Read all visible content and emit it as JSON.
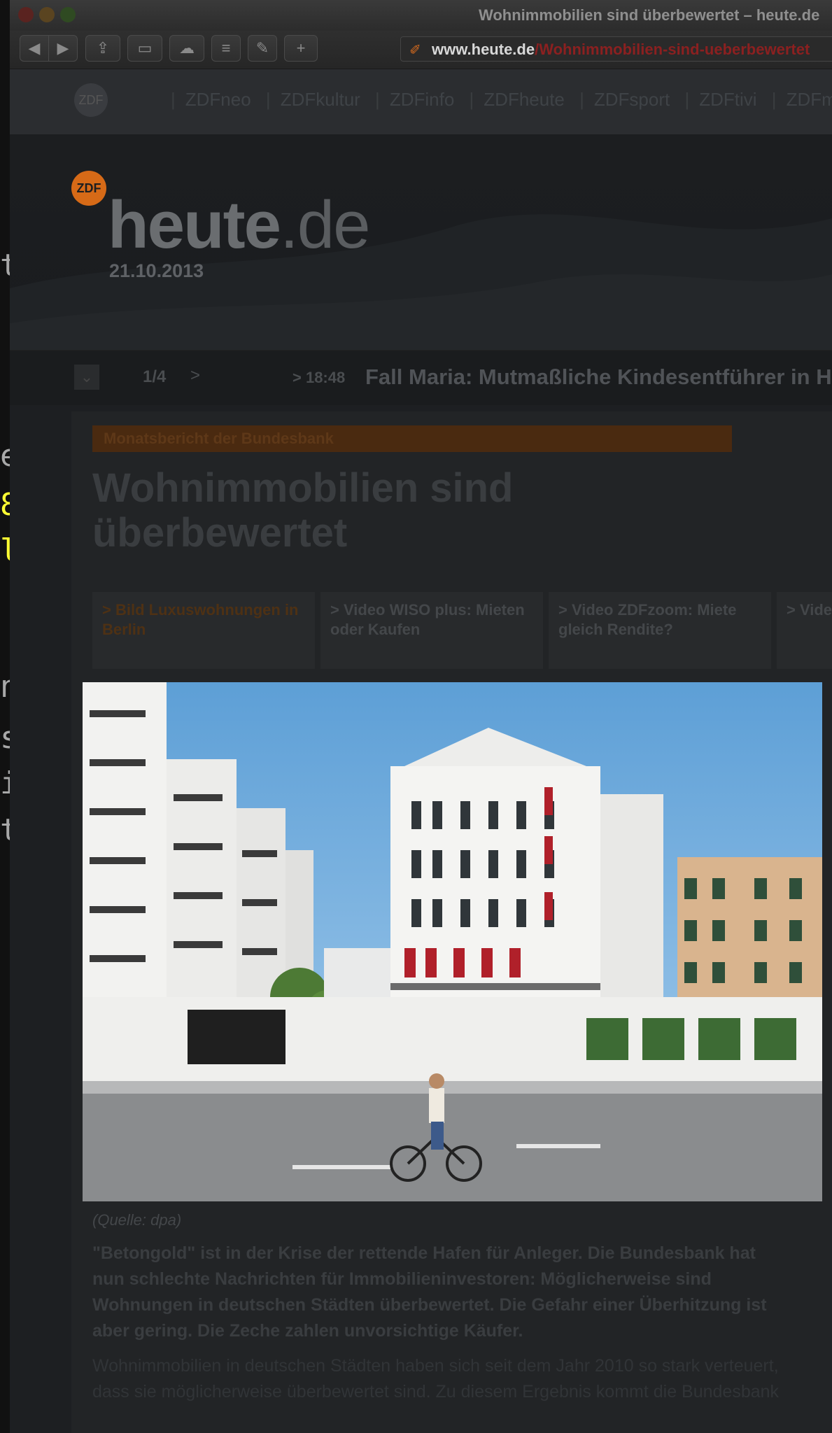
{
  "terminal": {
    "chars": [
      "t",
      "e",
      "8",
      "l",
      "n",
      "s",
      "i",
      "t"
    ]
  },
  "window": {
    "title": "Wohnimmobilien sind überbewertet – heute.de"
  },
  "toolbar": {
    "url_host": "www.heute.de",
    "url_path": "/Wohnimmobilien-sind-ueberbewertet"
  },
  "network": {
    "logo": "ZDF",
    "links": [
      "ZDFneo",
      "ZDFkultur",
      "ZDFinfo",
      "ZDFheute",
      "ZDFsport",
      "ZDFtivi",
      "ZDFmediathek"
    ]
  },
  "header": {
    "badge": "ZDF",
    "brand_main": "heute",
    "brand_tld": ".de",
    "date": "21.10.2013"
  },
  "ticker": {
    "count": "1/4",
    "next": ">",
    "time": "> 18:48",
    "headline": "Fall Maria: Mutmaßliche Kindesentführer in Haft"
  },
  "article": {
    "kicker": "Monatsbericht der Bundesbank",
    "headline": "Wohnimmobilien sind überbewertet",
    "related": [
      {
        "label": "> Bild Luxuswohnungen in Berlin"
      },
      {
        "label": "> Video WISO plus: Mieten oder Kaufen"
      },
      {
        "label": "> Video ZDFzoom: Miete gleich Rendite?"
      },
      {
        "label": "> Video ZDF heute: Haus"
      }
    ],
    "caption": "(Quelle: dpa)",
    "lead_lines": [
      "\"Betongold\" ist in der Krise der rettende Hafen für Anleger. Die Bundesbank hat",
      "nun schlechte Nachrichten für Immobilieninvestoren: Möglicherweise sind",
      "Wohnungen in deutschen Städten überbewertet. Die Gefahr einer Überhitzung ist",
      "aber gering. Die Zeche zahlen unvorsichtige Käufer."
    ],
    "body_lines": [
      "Wohnimmobilien in deutschen Städten haben sich seit dem Jahr 2010 so stark verteuert,",
      "dass sie möglicherweise überbewertet sind. Zu diesem Ergebnis kommt die Bundesbank"
    ]
  },
  "colors": {
    "accent": "#d66a17",
    "dim_overlay": "#1d1f22"
  }
}
